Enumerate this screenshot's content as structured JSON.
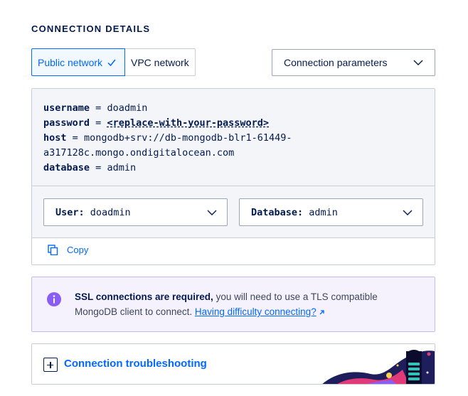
{
  "section_title": "CONNECTION DETAILS",
  "network_tabs": [
    {
      "label": "Public network",
      "active": true
    },
    {
      "label": "VPC network",
      "active": false
    }
  ],
  "parameters_select": {
    "value": "Connection parameters"
  },
  "code": {
    "username_key": "username",
    "username_value": "doadmin",
    "password_key": "password",
    "password_value": "<replace-with-your-password>",
    "host_key": "host",
    "host_value_line1": "mongodb+srv://db-mongodb-blr1-61449-",
    "host_value_line2": "a317128c.mongo.ondigitalocean.com",
    "database_key": "database",
    "database_value": "admin",
    "equals": "="
  },
  "user_select": {
    "label": "User:",
    "value": "doadmin"
  },
  "database_select": {
    "label": "Database:",
    "value": "admin"
  },
  "copy_label": "Copy",
  "alert": {
    "bold": "SSL connections are required,",
    "text": " you will need to use a TLS compatible MongoDB client to connect. ",
    "link": "Having difficulty connecting?"
  },
  "troubleshooting_label": "Connection troubleshooting",
  "colors": {
    "accent": "#0069ff",
    "text": "#031b4e",
    "alert_bg": "#f5f2fe",
    "alert_icon": "#8b5cf6"
  }
}
